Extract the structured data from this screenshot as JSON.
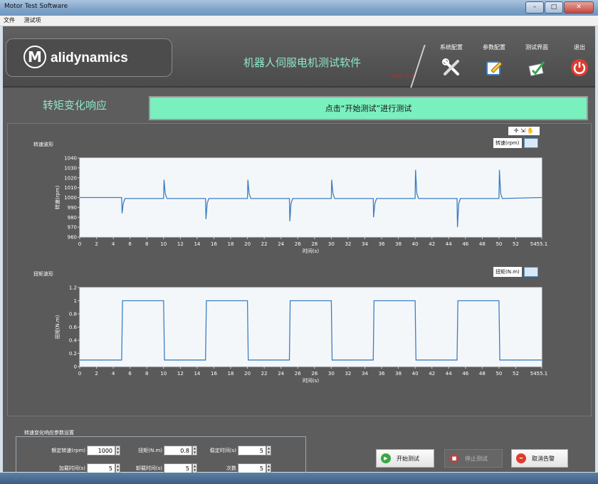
{
  "window": {
    "title": "Motor Test Software",
    "colors": {
      "accent": "#7bf0bf",
      "series": "#3b7fc4"
    }
  },
  "menu": [
    "文件",
    "测试项"
  ],
  "header": {
    "logo_text": "alidynamics",
    "app_title": "机器人伺服电机测试软件",
    "version": "2015.12.20",
    "nav": [
      {
        "label": "系统配置",
        "icon": "tools-icon"
      },
      {
        "label": "参数配置",
        "icon": "edit-icon"
      },
      {
        "label": "测试界面",
        "icon": "test-icon"
      },
      {
        "label": "退出",
        "icon": "power-icon"
      }
    ]
  },
  "page": {
    "title": "转矩变化响应",
    "status": "点击“开始测试”进行测试"
  },
  "chart_data": [
    {
      "type": "line",
      "title": "转速波形",
      "xlabel": "时间(s)",
      "ylabel": "转速(rpm)",
      "legend": "转速(rpm)",
      "xlim": [
        0,
        55.1
      ],
      "ylim": [
        960,
        1040
      ],
      "xticks": [
        "0",
        "2",
        "4",
        "6",
        "8",
        "10",
        "12",
        "14",
        "16",
        "18",
        "20",
        "22",
        "24",
        "26",
        "28",
        "30",
        "32",
        "34",
        "36",
        "38",
        "40",
        "42",
        "44",
        "46",
        "48",
        "50",
        "52",
        "5455.1"
      ],
      "yticks": [
        "960",
        "970",
        "980",
        "990",
        "1000",
        "1010",
        "1020",
        "1030",
        "1040"
      ],
      "x": [
        0,
        5,
        5.05,
        5.2,
        5.4,
        10,
        10.05,
        10.2,
        10.4,
        15,
        15.05,
        15.2,
        15.4,
        20,
        20.05,
        20.2,
        20.4,
        25,
        25.05,
        25.2,
        25.4,
        30,
        30.05,
        30.2,
        30.4,
        35,
        35.05,
        35.2,
        35.4,
        40,
        40.05,
        40.2,
        40.4,
        45,
        45.05,
        45.2,
        45.4,
        50,
        50.05,
        50.2,
        50.4,
        55.1
      ],
      "y": [
        1000,
        1000,
        984,
        994,
        999,
        999,
        1018,
        1004,
        999,
        999,
        978,
        994,
        999,
        999,
        1018,
        1004,
        999,
        999,
        976,
        994,
        999,
        999,
        1018,
        1004,
        999,
        999,
        980,
        994,
        999,
        999,
        1028,
        1004,
        999,
        999,
        970,
        994,
        999,
        999,
        1028,
        1004,
        999,
        1000
      ]
    },
    {
      "type": "line",
      "title": "扭矩波形",
      "xlabel": "时间(s)",
      "ylabel": "扭矩(N.m)",
      "legend": "扭矩(N.m)",
      "xlim": [
        0,
        55.1
      ],
      "ylim": [
        0,
        1.2
      ],
      "xticks": [
        "0",
        "2",
        "4",
        "6",
        "8",
        "10",
        "12",
        "14",
        "16",
        "18",
        "20",
        "22",
        "24",
        "26",
        "28",
        "30",
        "32",
        "34",
        "36",
        "38",
        "40",
        "42",
        "44",
        "46",
        "48",
        "50",
        "52",
        "5455.1"
      ],
      "yticks": [
        "0",
        "0.2",
        "0.4",
        "0.6",
        "0.8",
        "1",
        "1.2"
      ],
      "x": [
        0,
        5,
        5.1,
        10,
        10.1,
        15,
        15.1,
        20,
        20.1,
        25,
        25.1,
        30,
        30.1,
        35,
        35.1,
        40,
        40.1,
        45,
        45.1,
        50,
        50.1,
        55.1
      ],
      "y": [
        0.1,
        0.1,
        1.0,
        1.0,
        0.1,
        0.1,
        1.0,
        1.0,
        0.1,
        0.1,
        1.0,
        1.0,
        0.1,
        0.1,
        1.0,
        1.0,
        0.1,
        0.1,
        1.0,
        1.0,
        0.1,
        0.1
      ]
    }
  ],
  "params": {
    "title": "转速变化响应参数设置",
    "fields": [
      {
        "label": "额定转速(rpm)",
        "value": "1000"
      },
      {
        "label": "扭矩(N.m)",
        "value": "0.8"
      },
      {
        "label": "稳定时间(s)",
        "value": "5"
      },
      {
        "label": "加载时间(s)",
        "value": "5"
      },
      {
        "label": "卸载时间(s)",
        "value": "5"
      },
      {
        "label": "次数",
        "value": "5"
      }
    ]
  },
  "buttons": {
    "start": "开始测试",
    "stop": "停止测试",
    "cancel_alarm": "取消告警"
  }
}
